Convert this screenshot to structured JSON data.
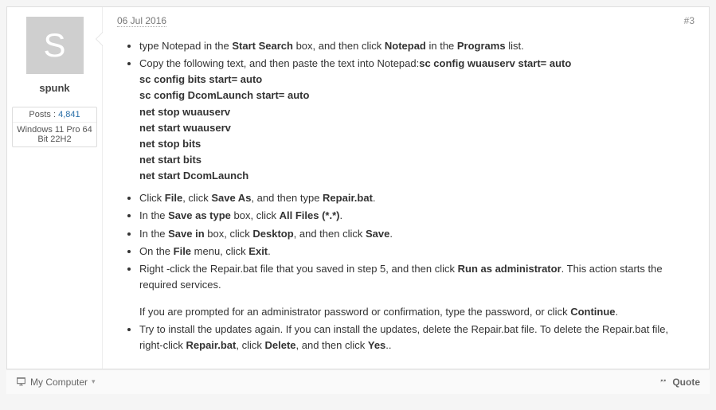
{
  "post": {
    "date": "06 Jul 2016",
    "number": "#3",
    "author": {
      "avatar_letter": "S",
      "name": "spunk",
      "posts_label": "Posts :",
      "posts_count": "4,841",
      "os": "Windows 11 Pro 64 Bit 22H2"
    },
    "body": {
      "li1_a": "type Notepad in the ",
      "li1_b": "Start Search",
      "li1_c": " box, and then click ",
      "li1_d": "Notepad",
      "li1_e": " in the ",
      "li1_f": "Programs",
      "li1_g": " list.",
      "li2_a": "Copy the following text, and then paste the text into Notepad:",
      "cmds": [
        "sc config wuauserv start= auto",
        "sc config bits start= auto",
        "sc config DcomLaunch start= auto",
        "net stop wuauserv",
        "net start wuauserv",
        "net stop bits",
        "net start bits",
        "net start DcomLaunch"
      ],
      "li3_a": "Click ",
      "li3_b": "File",
      "li3_c": ", click ",
      "li3_d": "Save As",
      "li3_e": ", and then type ",
      "li3_f": "Repair.bat",
      "li3_g": ".",
      "li4_a": "In the ",
      "li4_b": "Save as type",
      "li4_c": " box, click ",
      "li4_d": "All Files (*.*)",
      "li4_e": ".",
      "li5_a": "In the ",
      "li5_b": "Save in",
      "li5_c": " box, click ",
      "li5_d": "Desktop",
      "li5_e": ", and then click ",
      "li5_f": "Save",
      "li5_g": ".",
      "li6_a": "On the ",
      "li6_b": "File",
      "li6_c": " menu, click ",
      "li6_d": "Exit",
      "li6_e": ".",
      "li7_a": "Right -click the Repair.bat file that you saved in step 5, and then click ",
      "li7_b": "Run as administrator",
      "li7_c": ". This action starts the required services.",
      "li7_trail_a": " If you are prompted for an administrator password or confirmation, type the password, or click ",
      "li7_trail_b": "Continue",
      "li7_trail_c": ".",
      "li8_a": "Try to install the updates again. If you can install the updates, delete the Repair.bat file. To delete the Repair.bat file, right-click ",
      "li8_b": "Repair.bat",
      "li8_c": ", click ",
      "li8_d": "Delete",
      "li8_e": ", and then click ",
      "li8_f": "Yes",
      "li8_g": ".."
    },
    "footer": {
      "my_computer": "My Computer",
      "quote": "Quote"
    }
  }
}
